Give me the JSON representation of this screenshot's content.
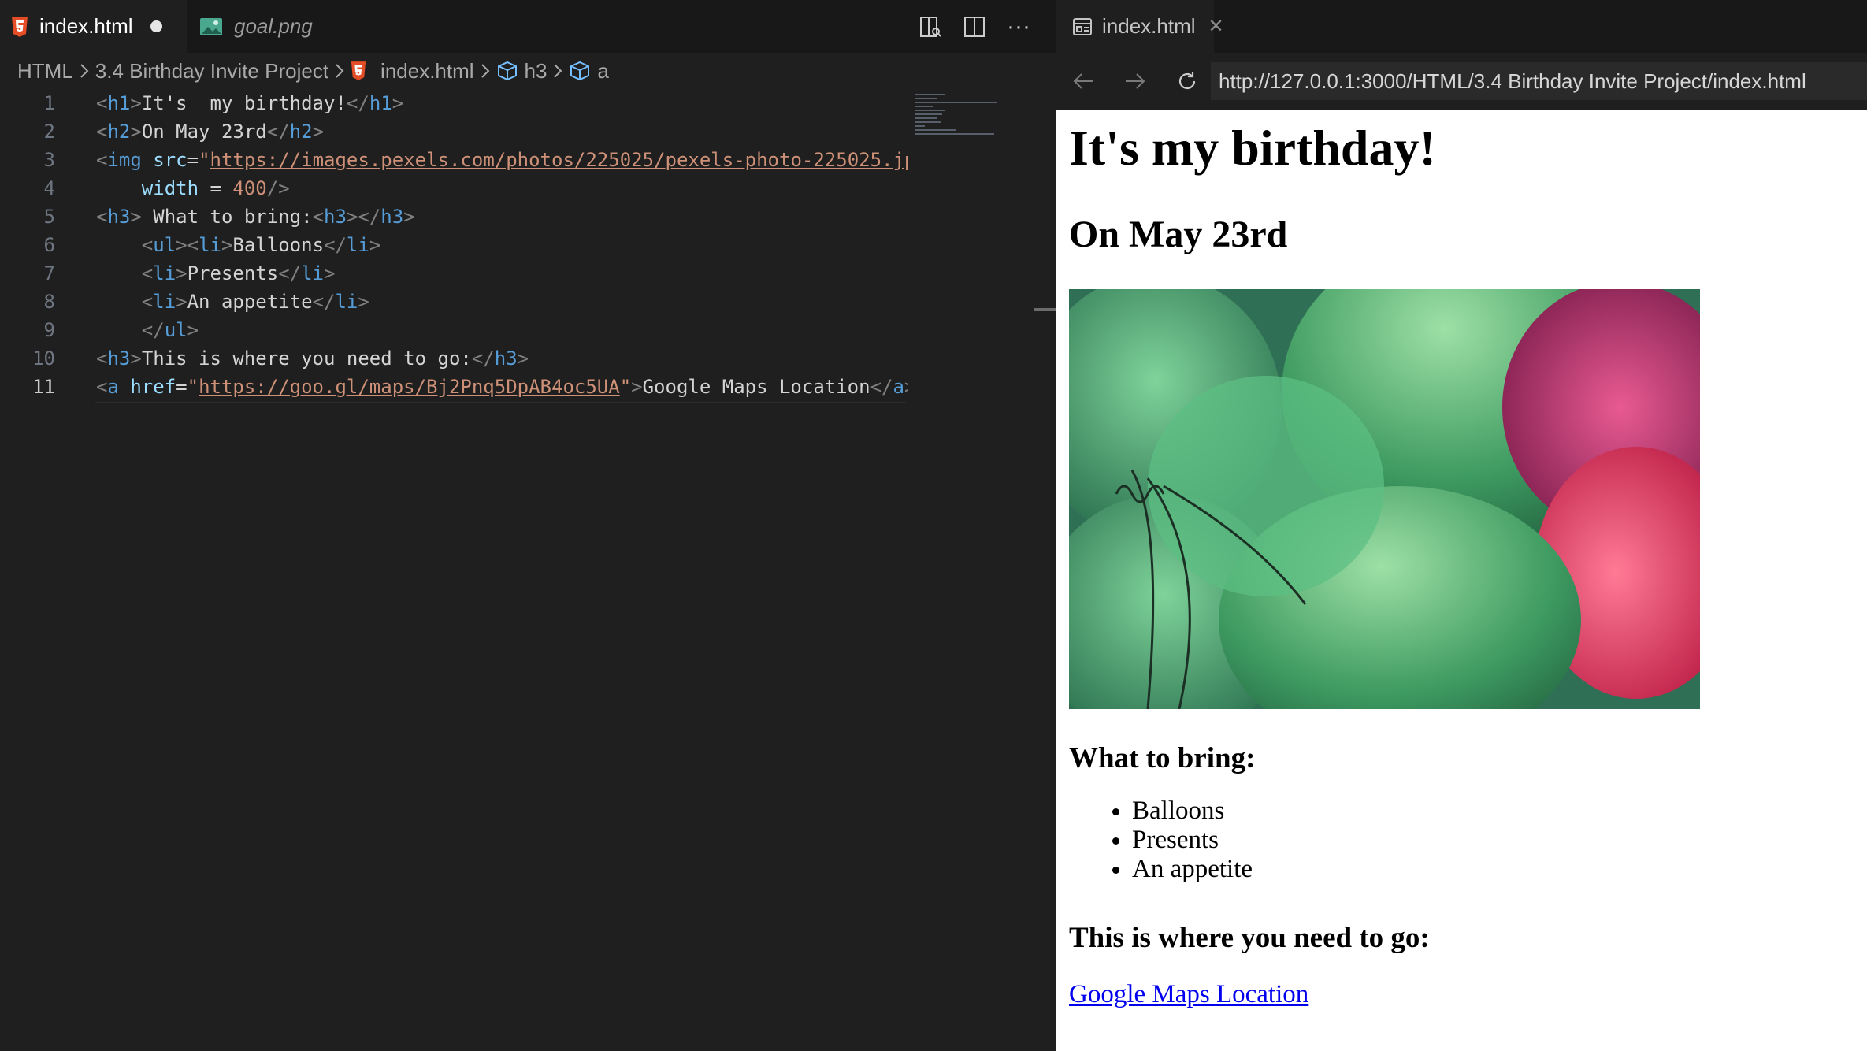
{
  "editor": {
    "tabs": [
      {
        "label": "index.html",
        "icon": "html5-icon",
        "dirty": true
      },
      {
        "label": "goal.png",
        "icon": "image-icon"
      }
    ],
    "actions": [
      "open-preview-icon",
      "split-editor-icon",
      "more-icon"
    ],
    "breadcrumb": [
      "HTML",
      "3.4 Birthday Invite Project",
      "index.html",
      "h3",
      "a"
    ],
    "current_line": 11,
    "lines": [
      {
        "n": "1",
        "tokens": [
          [
            "br",
            "<"
          ],
          [
            "tg",
            "h1"
          ],
          [
            "br",
            ">"
          ],
          [
            "tx",
            "It's  my birthday!"
          ],
          [
            "br",
            "</"
          ],
          [
            "tg",
            "h1"
          ],
          [
            "br",
            ">"
          ]
        ]
      },
      {
        "n": "2",
        "tokens": [
          [
            "br",
            "<"
          ],
          [
            "tg",
            "h2"
          ],
          [
            "br",
            ">"
          ],
          [
            "tx",
            "On May 23rd"
          ],
          [
            "br",
            "</"
          ],
          [
            "tg",
            "h2"
          ],
          [
            "br",
            ">"
          ]
        ]
      },
      {
        "n": "3",
        "tokens": [
          [
            "br",
            "<"
          ],
          [
            "tg",
            "img"
          ],
          [
            "tx",
            " "
          ],
          [
            "at",
            "src"
          ],
          [
            "tx",
            "="
          ],
          [
            "sv",
            "\""
          ],
          [
            "url",
            "https://images.pexels.com/photos/225025/pexels-photo-225025.jpeg"
          ]
        ]
      },
      {
        "n": "4",
        "tokens": [
          [
            "tx",
            "    "
          ],
          [
            "at",
            "width"
          ],
          [
            "tx",
            " = "
          ],
          [
            "sv",
            "400"
          ],
          [
            "br",
            "/>"
          ]
        ]
      },
      {
        "n": "5",
        "tokens": [
          [
            "br",
            "<"
          ],
          [
            "tg",
            "h3"
          ],
          [
            "br",
            ">"
          ],
          [
            "tx",
            " What to bring:"
          ],
          [
            "br",
            "<"
          ],
          [
            "tg",
            "h3"
          ],
          [
            "br",
            "></"
          ],
          [
            "tg",
            "h3"
          ],
          [
            "br",
            ">"
          ]
        ]
      },
      {
        "n": "6",
        "tokens": [
          [
            "tx",
            "    "
          ],
          [
            "br",
            "<"
          ],
          [
            "tg",
            "ul"
          ],
          [
            "br",
            "><"
          ],
          [
            "tg",
            "li"
          ],
          [
            "br",
            ">"
          ],
          [
            "tx",
            "Balloons"
          ],
          [
            "br",
            "</"
          ],
          [
            "tg",
            "li"
          ],
          [
            "br",
            ">"
          ]
        ]
      },
      {
        "n": "7",
        "tokens": [
          [
            "tx",
            "    "
          ],
          [
            "br",
            "<"
          ],
          [
            "tg",
            "li"
          ],
          [
            "br",
            ">"
          ],
          [
            "tx",
            "Presents"
          ],
          [
            "br",
            "</"
          ],
          [
            "tg",
            "li"
          ],
          [
            "br",
            ">"
          ]
        ]
      },
      {
        "n": "8",
        "tokens": [
          [
            "tx",
            "    "
          ],
          [
            "br",
            "<"
          ],
          [
            "tg",
            "li"
          ],
          [
            "br",
            ">"
          ],
          [
            "tx",
            "An appetite"
          ],
          [
            "br",
            "</"
          ],
          [
            "tg",
            "li"
          ],
          [
            "br",
            ">"
          ]
        ]
      },
      {
        "n": "9",
        "tokens": [
          [
            "tx",
            "    "
          ],
          [
            "br",
            "</"
          ],
          [
            "tg",
            "ul"
          ],
          [
            "br",
            ">"
          ]
        ]
      },
      {
        "n": "10",
        "tokens": [
          [
            "br",
            "<"
          ],
          [
            "tg",
            "h3"
          ],
          [
            "br",
            ">"
          ],
          [
            "tx",
            "This is where you need to go:"
          ],
          [
            "br",
            "</"
          ],
          [
            "tg",
            "h3"
          ],
          [
            "br",
            ">"
          ]
        ]
      },
      {
        "n": "11",
        "tokens": [
          [
            "br",
            "<"
          ],
          [
            "tg",
            "a"
          ],
          [
            "tx",
            " "
          ],
          [
            "at",
            "href"
          ],
          [
            "tx",
            "="
          ],
          [
            "sv",
            "\""
          ],
          [
            "url",
            "https://goo.gl/maps/Bj2Pnq5DpAB4oc5UA"
          ],
          [
            "sv",
            "\""
          ],
          [
            "br",
            ">"
          ],
          [
            "tx",
            "Google Maps Location"
          ],
          [
            "br",
            "</"
          ],
          [
            "tg",
            "a"
          ],
          [
            "br",
            ">"
          ]
        ]
      }
    ]
  },
  "preview": {
    "tab_label": "index.html",
    "url": "http://127.0.0.1:3000/HTML/3.4 Birthday Invite Project/index.html",
    "page": {
      "h1": "It's my birthday!",
      "h2": "On May 23rd",
      "image": "balloons-photo",
      "h3_bring": "What to bring:",
      "items": [
        "Balloons",
        "Presents",
        "An appetite"
      ],
      "h3_where": "This is where you need to go:",
      "link": "Google Maps Location"
    }
  },
  "colors": {
    "editor_bg": "#1f1f1f",
    "tag": "#569cd6",
    "attribute": "#9cdcfe",
    "string": "#ce9178",
    "link": "#0000ee"
  }
}
